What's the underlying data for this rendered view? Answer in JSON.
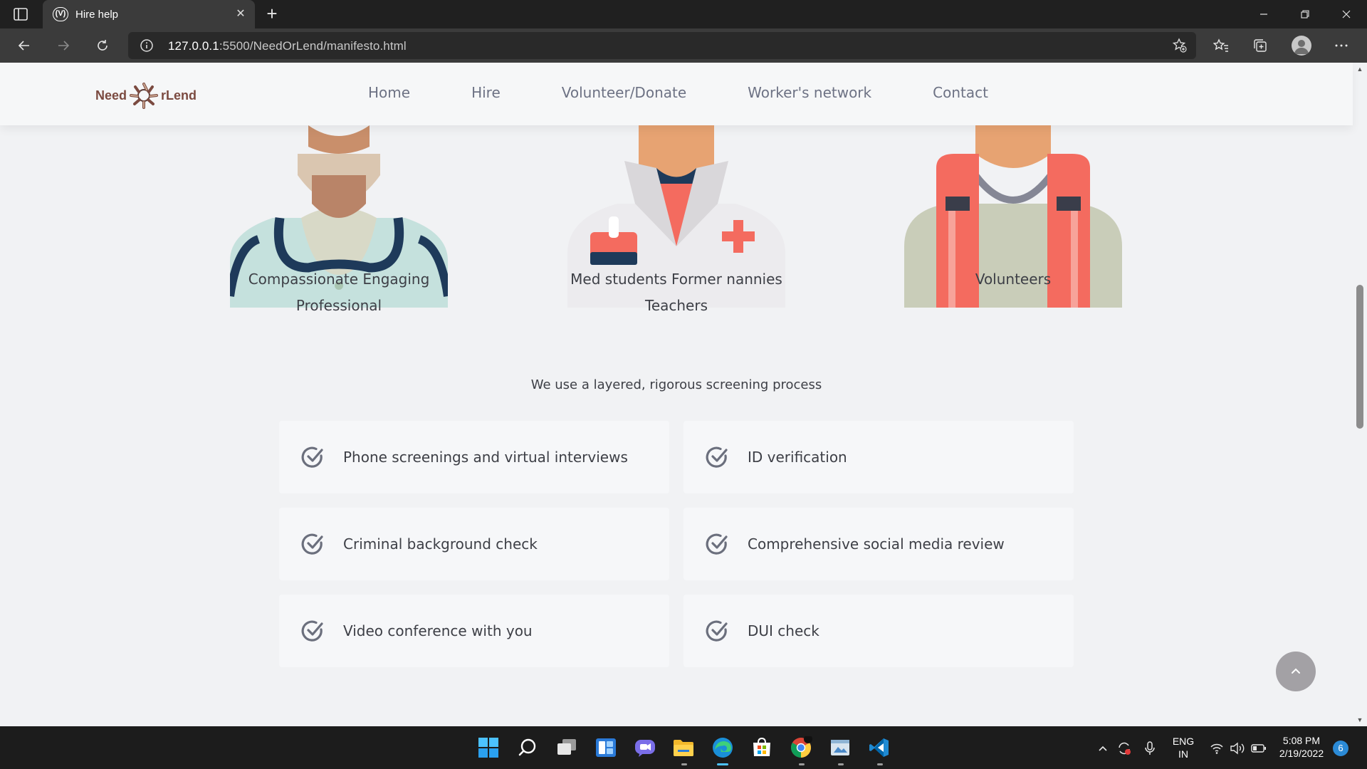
{
  "browser": {
    "tab": {
      "title": "Hire help",
      "favicon_text": "(V)"
    },
    "address": {
      "host": "127.0.0.1",
      "rest": ":5500/NeedOrLend/manifesto.html"
    }
  },
  "site": {
    "logo": {
      "left": "Need",
      "right": "rLend"
    },
    "nav": [
      "Home",
      "Hire",
      "Volunteer/Donate",
      "Worker's network",
      "Contact"
    ]
  },
  "personas": [
    {
      "line1": "Compassionate Engaging",
      "line2": "Professional"
    },
    {
      "line1": "Med students Former nannies",
      "line2": "Teachers"
    },
    {
      "line1": "Volunteers",
      "line2": ""
    }
  ],
  "screening": {
    "title": "We use a layered, rigorous screening process",
    "items": [
      "Phone screenings and virtual interviews",
      "ID verification",
      "Criminal background check",
      "Comprehensive social media review",
      "Video conference with you",
      "DUI check"
    ]
  },
  "taskbar": {
    "language": {
      "line1": "ENG",
      "line2": "IN"
    },
    "time": "5:08 PM",
    "date": "2/19/2022",
    "notification_count": "6"
  },
  "colors": {
    "accent_edge": "#4cc2ff",
    "nav_text": "#6d7284",
    "scroll_top_bg": "#a3a1a5"
  }
}
